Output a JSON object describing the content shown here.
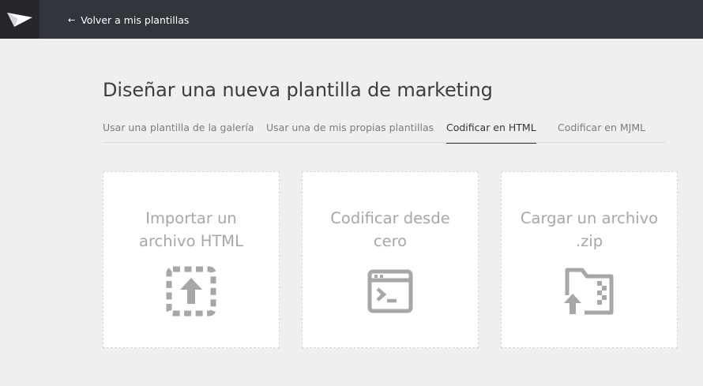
{
  "topbar": {
    "logo_icon": "paper-plane-logo",
    "back_icon": "arrow-left-icon",
    "back_arrow": "←",
    "back_label": "Volver a mis plantillas"
  },
  "page": {
    "title": "Diseñar una nueva plantilla de marketing"
  },
  "tabs": [
    {
      "label": "Usar una plantilla de la galería",
      "active": false
    },
    {
      "label": "Usar una de mis propias plantillas",
      "active": false
    },
    {
      "label": "Codificar en HTML",
      "active": true
    },
    {
      "label": "Codificar en MJML",
      "active": false
    }
  ],
  "cards": [
    {
      "line1": "Importar un",
      "line2": "archivo HTML",
      "icon": "upload-dashed-box-icon"
    },
    {
      "line1": "Codificar desde",
      "line2": "cero",
      "icon": "terminal-window-icon"
    },
    {
      "line1": "Cargar un archivo",
      "line2": ".zip",
      "icon": "zip-folder-upload-icon"
    }
  ],
  "colors": {
    "topbar": "#33353d",
    "logo_bg": "#26272d",
    "page_bg": "#efefef",
    "icon_gray": "#a6a7ab"
  }
}
